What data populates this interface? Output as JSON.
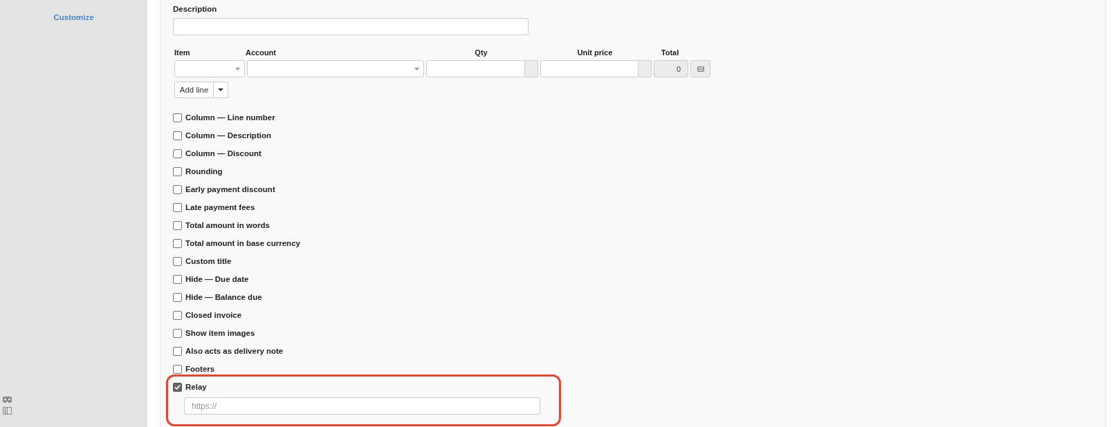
{
  "sidebar": {
    "links": [
      "Customize"
    ]
  },
  "form": {
    "description": {
      "label": "Description"
    },
    "lines": {
      "columns": [
        "Item",
        "Account",
        "Qty",
        "Unit price",
        "Total"
      ],
      "row": {
        "total": "0"
      },
      "add_button": "Add line"
    },
    "options": [
      {
        "label": "Column — Line number",
        "checked": false
      },
      {
        "label": "Column — Description",
        "checked": false
      },
      {
        "label": "Column — Discount",
        "checked": false
      },
      {
        "label": "Rounding",
        "checked": false
      },
      {
        "label": "Early payment discount",
        "checked": false
      },
      {
        "label": "Late payment fees",
        "checked": false
      },
      {
        "label": "Total amount in words",
        "checked": false
      },
      {
        "label": "Total amount in base currency",
        "checked": false
      },
      {
        "label": "Custom title",
        "checked": false
      },
      {
        "label": "Hide — Due date",
        "checked": false
      },
      {
        "label": "Hide — Balance due",
        "checked": false
      },
      {
        "label": "Closed invoice",
        "checked": false
      },
      {
        "label": "Show item images",
        "checked": false
      },
      {
        "label": "Also acts as delivery note",
        "checked": false
      },
      {
        "label": "Footers",
        "checked": false
      },
      {
        "label": "Relay",
        "checked": true,
        "highlighted": true,
        "field": {
          "placeholder": "https://"
        }
      }
    ]
  }
}
